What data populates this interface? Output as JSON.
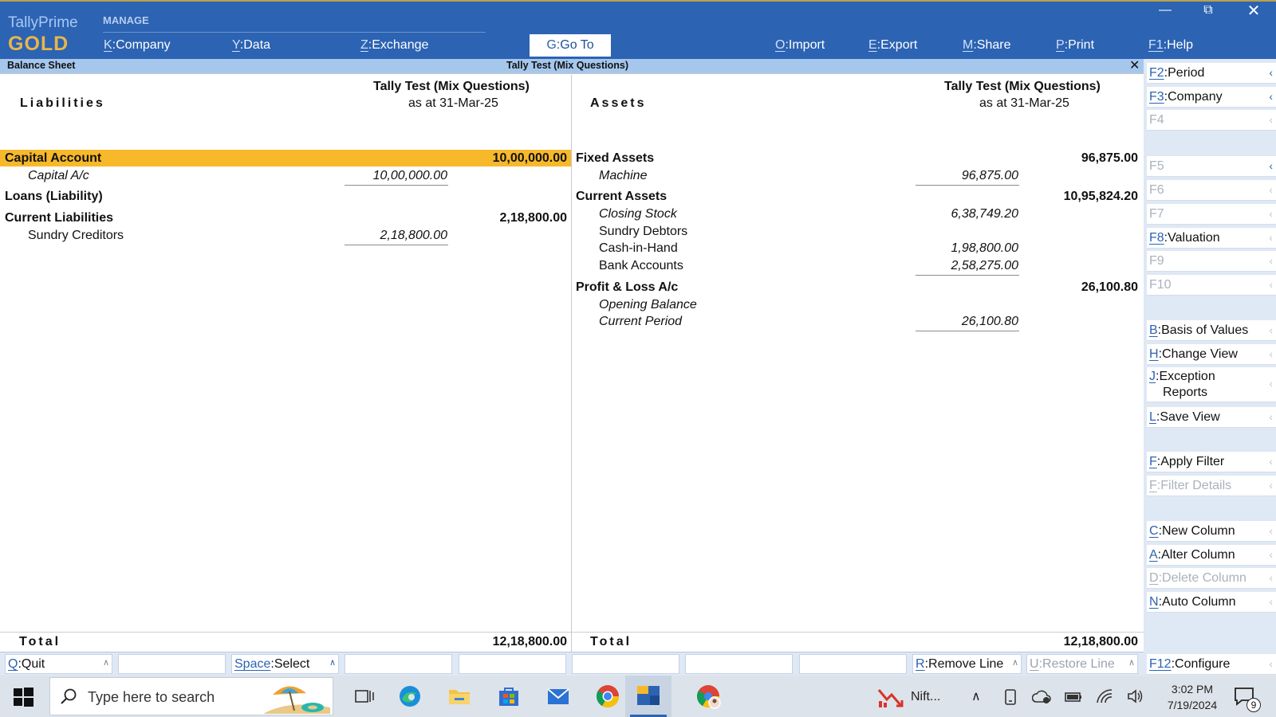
{
  "app": {
    "brand_name": "TallyPrime",
    "brand_edition": "GOLD",
    "manage_label": "MANAGE"
  },
  "menu": {
    "company": {
      "key": "K",
      "label": "Company"
    },
    "data": {
      "key": "Y",
      "label": "Data"
    },
    "exchange": {
      "key": "Z",
      "label": "Exchange"
    },
    "goto": {
      "key": "G",
      "label": "Go To"
    },
    "import": {
      "key": "O",
      "label": "Import"
    },
    "export": {
      "key": "E",
      "label": "Export"
    },
    "share": {
      "key": "M",
      "label": "Share"
    },
    "print": {
      "key": "P",
      "label": "Print"
    },
    "help": {
      "key": "F1",
      "label": "Help"
    }
  },
  "titlebar": {
    "left": "Balance Sheet",
    "center": "Tally Test (Mix Questions)"
  },
  "report": {
    "left_caption": "Liabilities",
    "right_caption": "Assets",
    "company_name": "Tally Test (Mix Questions)",
    "as_at": "as at 31-Mar-25",
    "liabilities": {
      "capital_account": "Capital Account",
      "capital_account_total": "10,00,000.00",
      "capital_ac": "Capital A/c",
      "capital_ac_value": "10,00,000.00",
      "loans": "Loans (Liability)",
      "current_liabilities": "Current Liabilities",
      "current_liabilities_total": "2,18,800.00",
      "sundry_creditors": "Sundry Creditors",
      "sundry_creditors_value": "2,18,800.00"
    },
    "assets": {
      "fixed_assets": "Fixed Assets",
      "fixed_assets_total": "96,875.00",
      "machine": "Machine",
      "machine_value": "96,875.00",
      "current_assets": "Current Assets",
      "current_assets_total": "10,95,824.20",
      "closing_stock": "Closing Stock",
      "closing_stock_value": "6,38,749.20",
      "sundry_debtors": "Sundry Debtors",
      "cash_in_hand": "Cash-in-Hand",
      "cash_in_hand_value": "1,98,800.00",
      "bank_accounts": "Bank Accounts",
      "bank_accounts_value": "2,58,275.00",
      "profit_loss": "Profit & Loss A/c",
      "profit_loss_total": "26,100.80",
      "opening_balance": "Opening Balance",
      "current_period": "Current Period",
      "current_period_value": "26,100.80"
    },
    "total_label": "Total",
    "left_total": "12,18,800.00",
    "right_total": "12,18,800.00"
  },
  "bottom": {
    "quit": {
      "key": "Q",
      "label": "Quit"
    },
    "select": {
      "key": "Space",
      "label": "Select"
    },
    "remove_line": {
      "key": "R",
      "label": "Remove Line"
    },
    "restore_line": {
      "key": "U",
      "label": "Restore Line"
    }
  },
  "sidebar": {
    "period": {
      "key": "F2",
      "label": "Period"
    },
    "company": {
      "key": "F3",
      "label": "Company"
    },
    "f4": "F4",
    "f5": "F5",
    "f6": "F6",
    "f7": "F7",
    "valuation": {
      "key": "F8",
      "label": "Valuation"
    },
    "f9": "F9",
    "f10": "F10",
    "basis": {
      "key": "B",
      "label": "Basis of Values"
    },
    "change_view": {
      "key": "H",
      "label": "Change View"
    },
    "exception": {
      "key": "J",
      "label1": "Exception",
      "label2": "Reports"
    },
    "save_view": {
      "key": "L",
      "label": "Save View"
    },
    "apply_filter": {
      "key": "F",
      "label": "Apply Filter"
    },
    "filter_details": {
      "key": "F",
      "label": "Filter Details"
    },
    "new_column": {
      "key": "C",
      "label": "New Column"
    },
    "alter_column": {
      "key": "A",
      "label": "Alter Column"
    },
    "delete_column": {
      "key": "D",
      "label": "Delete Column"
    },
    "auto_column": {
      "key": "N",
      "label": "Auto Column"
    },
    "configure": {
      "key": "F12",
      "label": "Configure"
    }
  },
  "taskbar": {
    "search_placeholder": "Type here to search",
    "nifty_label": "Nift...",
    "time": "3:02 PM",
    "date": "7/19/2024",
    "notification_count": "9"
  },
  "colors": {
    "brand_blue": "#2c63b3",
    "highlight": "#f7b92a",
    "gold": "#e8b64b"
  }
}
